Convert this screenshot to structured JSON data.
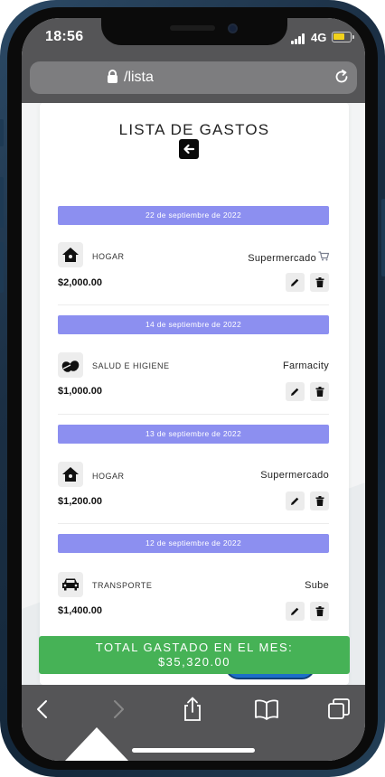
{
  "status_bar": {
    "time": "18:56",
    "network": "4G"
  },
  "browser": {
    "url": "/lista"
  },
  "page": {
    "title": "LISTA DE GASTOS",
    "expenses": [
      {
        "date": "22 de septiembre de 2022",
        "category": "HOGAR",
        "category_icon": "house-icon",
        "store": "Supermercado",
        "store_icon": "shopping-cart-icon",
        "amount": "$2,000.00"
      },
      {
        "date": "14 de septiembre de 2022",
        "category": "SALUD E HIGIENE",
        "category_icon": "pills-icon",
        "store": "Farmacity",
        "amount": "$1,000.00"
      },
      {
        "date": "13 de septiembre de 2022",
        "category": "HOGAR",
        "category_icon": "house-icon",
        "store": "Supermercado",
        "amount": "$1,200.00"
      },
      {
        "date": "12 de septiembre de 2022",
        "category": "TRANSPORTE",
        "category_icon": "car-icon",
        "store": "Sube",
        "amount": "$1,400.00"
      }
    ],
    "total": {
      "label": "TOTAL GASTADO EN EL MES:",
      "amount": "$35,320.00"
    }
  },
  "colors": {
    "date_header": "#8c8ff0",
    "total_bar": "#46b256",
    "toolbar": "#555557"
  }
}
